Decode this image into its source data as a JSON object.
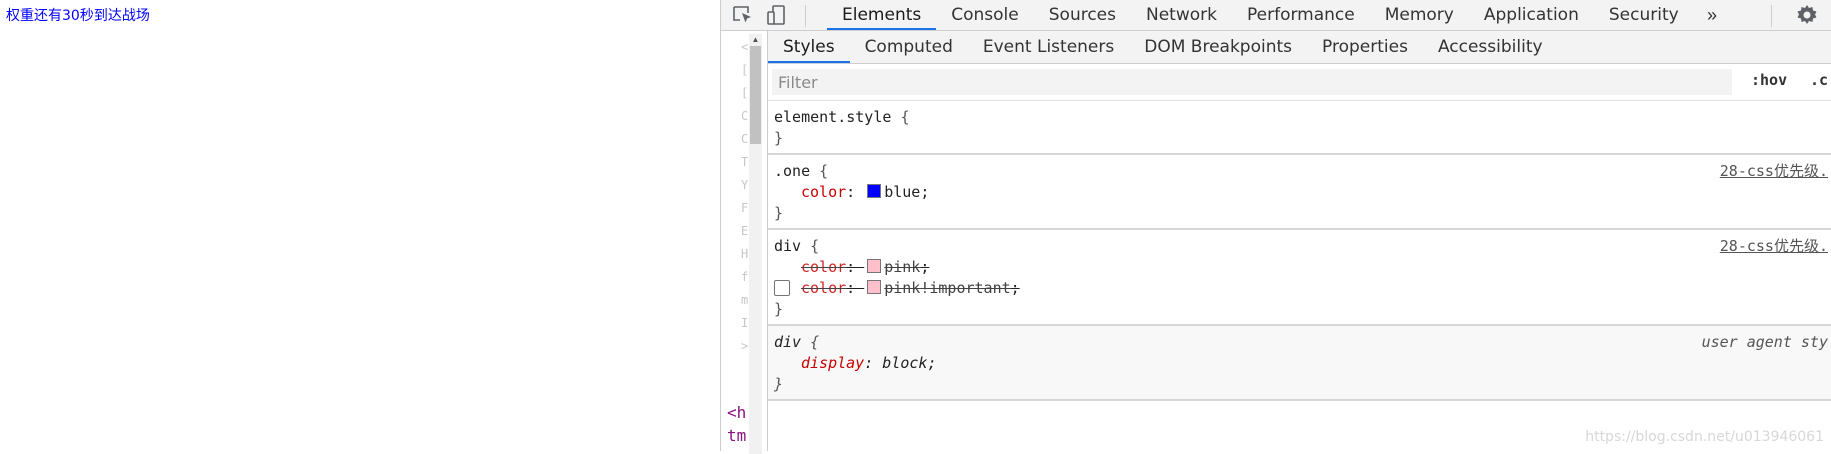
{
  "page": {
    "text": "权重还有30秒到达战场"
  },
  "toolbar": {
    "tabs": [
      "Elements",
      "Console",
      "Sources",
      "Network",
      "Performance",
      "Memory",
      "Application",
      "Security"
    ],
    "more_label": "»",
    "inspect_icon": "inspect-element-icon",
    "device_icon": "device-toolbar-icon",
    "settings_icon": "gear-icon"
  },
  "elements_gutter": [
    "<",
    "[",
    "[",
    "C",
    "C",
    "T",
    "Y",
    "F",
    "E",
    "H",
    "f",
    "m",
    "I",
    ">"
  ],
  "elements_code": [
    "<h",
    "tm"
  ],
  "styles_tabs": [
    "Styles",
    "Computed",
    "Event Listeners",
    "DOM Breakpoints",
    "Properties",
    "Accessibility"
  ],
  "filter": {
    "placeholder": "Filter",
    "hov": ":hov",
    "cls": ".c"
  },
  "rules": {
    "element_style": {
      "selector": "element.style",
      "open": "{",
      "close": "}"
    },
    "one": {
      "selector": ".one",
      "source": "28-css优先级.",
      "prop": "color",
      "value": "blue",
      "swatch": "#0000ff"
    },
    "div1": {
      "selector": "div",
      "source": "28-css优先级.",
      "decl1": {
        "prop": "color",
        "value": "pink",
        "swatch": "#ffc0cb"
      },
      "decl2": {
        "prop": "color",
        "value": "pink!important",
        "swatch": "#ffc0cb"
      }
    },
    "div_ua": {
      "selector": "div",
      "source": "user agent sty",
      "prop": "display",
      "value": "block"
    }
  },
  "watermark": "https://blog.csdn.net/u013946061"
}
